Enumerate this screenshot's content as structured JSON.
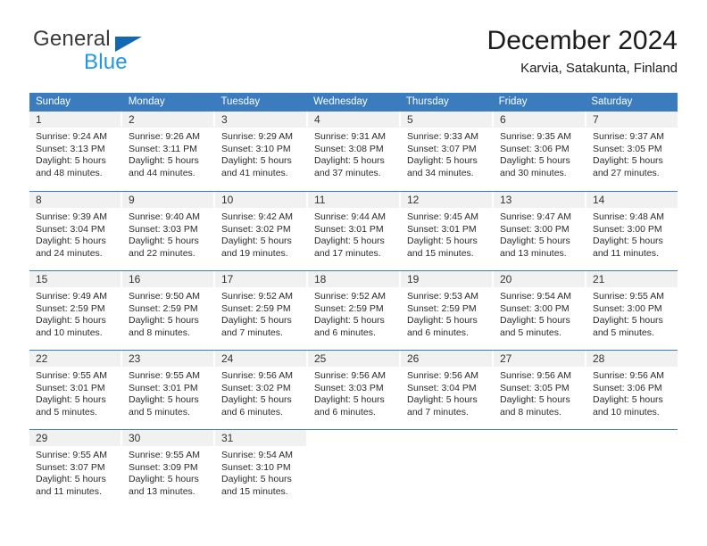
{
  "brand": {
    "name_top": "General",
    "name_bottom": "Blue",
    "triangle_color": "#1268b3",
    "blue_text_color": "#2196e3"
  },
  "header": {
    "title": "December 2024",
    "subtitle": "Karvia, Satakunta, Finland"
  },
  "theme": {
    "header_blue": "#3b7cbf",
    "day_number_bg": "#f1f1f1",
    "text": "#2b2b2b"
  },
  "weekdays": [
    "Sunday",
    "Monday",
    "Tuesday",
    "Wednesday",
    "Thursday",
    "Friday",
    "Saturday"
  ],
  "weeks": [
    [
      {
        "day": "1",
        "sunrise": "Sunrise: 9:24 AM",
        "sunset": "Sunset: 3:13 PM",
        "daylight1": "Daylight: 5 hours",
        "daylight2": "and 48 minutes."
      },
      {
        "day": "2",
        "sunrise": "Sunrise: 9:26 AM",
        "sunset": "Sunset: 3:11 PM",
        "daylight1": "Daylight: 5 hours",
        "daylight2": "and 44 minutes."
      },
      {
        "day": "3",
        "sunrise": "Sunrise: 9:29 AM",
        "sunset": "Sunset: 3:10 PM",
        "daylight1": "Daylight: 5 hours",
        "daylight2": "and 41 minutes."
      },
      {
        "day": "4",
        "sunrise": "Sunrise: 9:31 AM",
        "sunset": "Sunset: 3:08 PM",
        "daylight1": "Daylight: 5 hours",
        "daylight2": "and 37 minutes."
      },
      {
        "day": "5",
        "sunrise": "Sunrise: 9:33 AM",
        "sunset": "Sunset: 3:07 PM",
        "daylight1": "Daylight: 5 hours",
        "daylight2": "and 34 minutes."
      },
      {
        "day": "6",
        "sunrise": "Sunrise: 9:35 AM",
        "sunset": "Sunset: 3:06 PM",
        "daylight1": "Daylight: 5 hours",
        "daylight2": "and 30 minutes."
      },
      {
        "day": "7",
        "sunrise": "Sunrise: 9:37 AM",
        "sunset": "Sunset: 3:05 PM",
        "daylight1": "Daylight: 5 hours",
        "daylight2": "and 27 minutes."
      }
    ],
    [
      {
        "day": "8",
        "sunrise": "Sunrise: 9:39 AM",
        "sunset": "Sunset: 3:04 PM",
        "daylight1": "Daylight: 5 hours",
        "daylight2": "and 24 minutes."
      },
      {
        "day": "9",
        "sunrise": "Sunrise: 9:40 AM",
        "sunset": "Sunset: 3:03 PM",
        "daylight1": "Daylight: 5 hours",
        "daylight2": "and 22 minutes."
      },
      {
        "day": "10",
        "sunrise": "Sunrise: 9:42 AM",
        "sunset": "Sunset: 3:02 PM",
        "daylight1": "Daylight: 5 hours",
        "daylight2": "and 19 minutes."
      },
      {
        "day": "11",
        "sunrise": "Sunrise: 9:44 AM",
        "sunset": "Sunset: 3:01 PM",
        "daylight1": "Daylight: 5 hours",
        "daylight2": "and 17 minutes."
      },
      {
        "day": "12",
        "sunrise": "Sunrise: 9:45 AM",
        "sunset": "Sunset: 3:01 PM",
        "daylight1": "Daylight: 5 hours",
        "daylight2": "and 15 minutes."
      },
      {
        "day": "13",
        "sunrise": "Sunrise: 9:47 AM",
        "sunset": "Sunset: 3:00 PM",
        "daylight1": "Daylight: 5 hours",
        "daylight2": "and 13 minutes."
      },
      {
        "day": "14",
        "sunrise": "Sunrise: 9:48 AM",
        "sunset": "Sunset: 3:00 PM",
        "daylight1": "Daylight: 5 hours",
        "daylight2": "and 11 minutes."
      }
    ],
    [
      {
        "day": "15",
        "sunrise": "Sunrise: 9:49 AM",
        "sunset": "Sunset: 2:59 PM",
        "daylight1": "Daylight: 5 hours",
        "daylight2": "and 10 minutes."
      },
      {
        "day": "16",
        "sunrise": "Sunrise: 9:50 AM",
        "sunset": "Sunset: 2:59 PM",
        "daylight1": "Daylight: 5 hours",
        "daylight2": "and 8 minutes."
      },
      {
        "day": "17",
        "sunrise": "Sunrise: 9:52 AM",
        "sunset": "Sunset: 2:59 PM",
        "daylight1": "Daylight: 5 hours",
        "daylight2": "and 7 minutes."
      },
      {
        "day": "18",
        "sunrise": "Sunrise: 9:52 AM",
        "sunset": "Sunset: 2:59 PM",
        "daylight1": "Daylight: 5 hours",
        "daylight2": "and 6 minutes."
      },
      {
        "day": "19",
        "sunrise": "Sunrise: 9:53 AM",
        "sunset": "Sunset: 2:59 PM",
        "daylight1": "Daylight: 5 hours",
        "daylight2": "and 6 minutes."
      },
      {
        "day": "20",
        "sunrise": "Sunrise: 9:54 AM",
        "sunset": "Sunset: 3:00 PM",
        "daylight1": "Daylight: 5 hours",
        "daylight2": "and 5 minutes."
      },
      {
        "day": "21",
        "sunrise": "Sunrise: 9:55 AM",
        "sunset": "Sunset: 3:00 PM",
        "daylight1": "Daylight: 5 hours",
        "daylight2": "and 5 minutes."
      }
    ],
    [
      {
        "day": "22",
        "sunrise": "Sunrise: 9:55 AM",
        "sunset": "Sunset: 3:01 PM",
        "daylight1": "Daylight: 5 hours",
        "daylight2": "and 5 minutes."
      },
      {
        "day": "23",
        "sunrise": "Sunrise: 9:55 AM",
        "sunset": "Sunset: 3:01 PM",
        "daylight1": "Daylight: 5 hours",
        "daylight2": "and 5 minutes."
      },
      {
        "day": "24",
        "sunrise": "Sunrise: 9:56 AM",
        "sunset": "Sunset: 3:02 PM",
        "daylight1": "Daylight: 5 hours",
        "daylight2": "and 6 minutes."
      },
      {
        "day": "25",
        "sunrise": "Sunrise: 9:56 AM",
        "sunset": "Sunset: 3:03 PM",
        "daylight1": "Daylight: 5 hours",
        "daylight2": "and 6 minutes."
      },
      {
        "day": "26",
        "sunrise": "Sunrise: 9:56 AM",
        "sunset": "Sunset: 3:04 PM",
        "daylight1": "Daylight: 5 hours",
        "daylight2": "and 7 minutes."
      },
      {
        "day": "27",
        "sunrise": "Sunrise: 9:56 AM",
        "sunset": "Sunset: 3:05 PM",
        "daylight1": "Daylight: 5 hours",
        "daylight2": "and 8 minutes."
      },
      {
        "day": "28",
        "sunrise": "Sunrise: 9:56 AM",
        "sunset": "Sunset: 3:06 PM",
        "daylight1": "Daylight: 5 hours",
        "daylight2": "and 10 minutes."
      }
    ],
    [
      {
        "day": "29",
        "sunrise": "Sunrise: 9:55 AM",
        "sunset": "Sunset: 3:07 PM",
        "daylight1": "Daylight: 5 hours",
        "daylight2": "and 11 minutes."
      },
      {
        "day": "30",
        "sunrise": "Sunrise: 9:55 AM",
        "sunset": "Sunset: 3:09 PM",
        "daylight1": "Daylight: 5 hours",
        "daylight2": "and 13 minutes."
      },
      {
        "day": "31",
        "sunrise": "Sunrise: 9:54 AM",
        "sunset": "Sunset: 3:10 PM",
        "daylight1": "Daylight: 5 hours",
        "daylight2": "and 15 minutes."
      },
      {
        "day": "",
        "sunrise": "",
        "sunset": "",
        "daylight1": "",
        "daylight2": ""
      },
      {
        "day": "",
        "sunrise": "",
        "sunset": "",
        "daylight1": "",
        "daylight2": ""
      },
      {
        "day": "",
        "sunrise": "",
        "sunset": "",
        "daylight1": "",
        "daylight2": ""
      },
      {
        "day": "",
        "sunrise": "",
        "sunset": "",
        "daylight1": "",
        "daylight2": ""
      }
    ]
  ]
}
